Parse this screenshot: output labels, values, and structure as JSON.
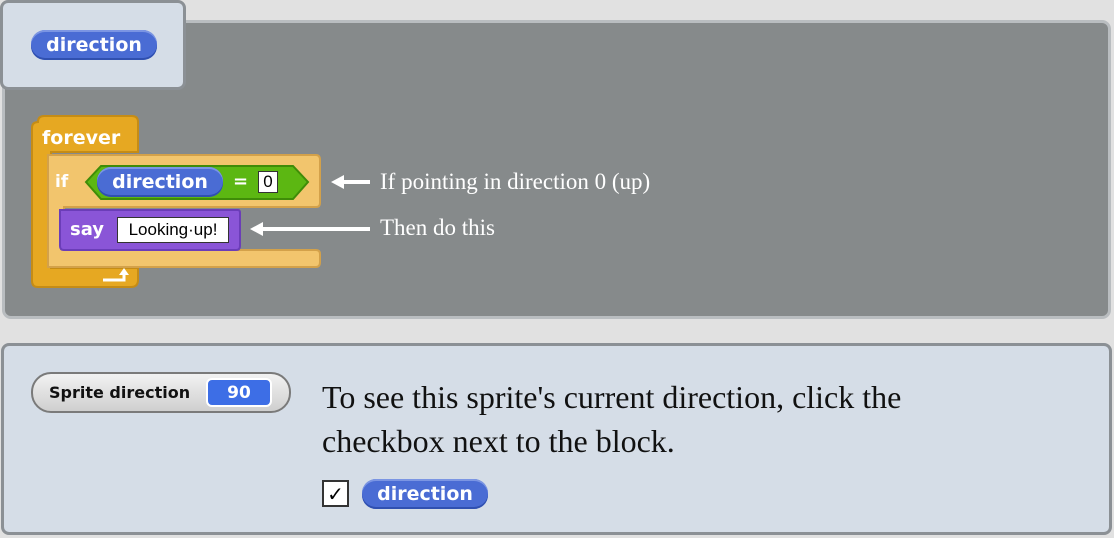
{
  "header": {
    "reporter_label": "direction"
  },
  "script": {
    "forever_label": "forever",
    "if_label": "if",
    "condition_reporter": "direction",
    "operator": "=",
    "compare_value": "0",
    "say_label": "say",
    "say_text": "Looking·up!"
  },
  "annotations": {
    "if_note": "If pointing in direction 0 (up)",
    "say_note": "Then do this"
  },
  "watcher": {
    "label": "Sprite direction",
    "value": "90"
  },
  "info": {
    "description": "To see this sprite's current direction, click the checkbox next to the block.",
    "checkbox_mark": "✓",
    "checkbox_reporter": "direction"
  },
  "colors": {
    "motion_blue": "#4a6cd4",
    "control_orange": "#e6a822",
    "operator_green": "#5cb712",
    "looks_purple": "#8a55d7",
    "stage_gray": "#868a8b"
  }
}
